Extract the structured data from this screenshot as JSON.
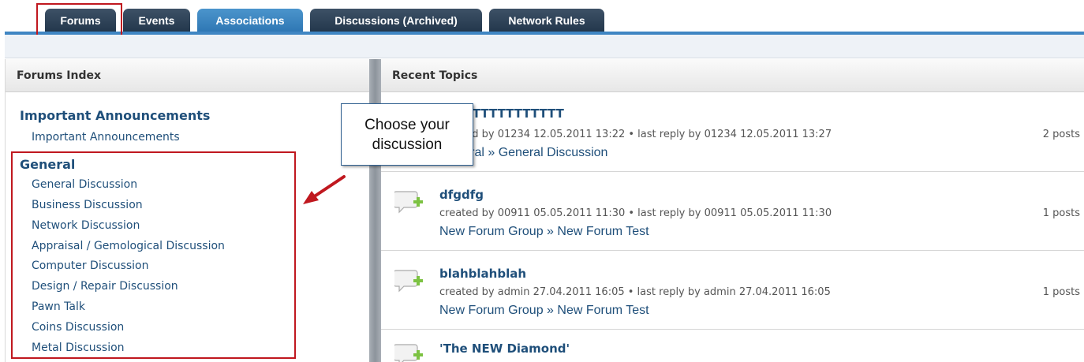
{
  "tabs": [
    {
      "label": "Forums",
      "active": false
    },
    {
      "label": "Events",
      "active": false
    },
    {
      "label": "Associations",
      "active": true
    },
    {
      "label": "Discussions (Archived)",
      "active": false
    },
    {
      "label": "Network Rules",
      "active": false
    }
  ],
  "left": {
    "header": "Forums Index",
    "groups": [
      {
        "title": "Important Announcements",
        "forums": [
          "Important Announcements"
        ]
      },
      {
        "title": "General",
        "forums": [
          "General Discussion",
          "Business Discussion",
          "Network Discussion",
          "Appraisal / Gemological Discussion",
          "Computer Discussion",
          "Design / Repair Discussion",
          "Pawn Talk",
          "Coins Discussion",
          "Metal Discussion"
        ]
      }
    ]
  },
  "right": {
    "header": "Recent Topics",
    "topics": [
      {
        "title": "TESTTTTTTTTTTTT",
        "meta": "created by 01234 12.05.2011 13:22 • last reply by 01234 12.05.2011 13:27",
        "posts": "2 posts",
        "crumb": "General » General Discussion"
      },
      {
        "title": "dfgdfg",
        "meta": "created by 00911 05.05.2011 11:30 • last reply by 00911 05.05.2011 11:30",
        "posts": "1 posts",
        "crumb": "New Forum Group » New Forum Test"
      },
      {
        "title": "blahblahblah",
        "meta": "created by admin 27.04.2011 16:05 • last reply by admin 27.04.2011 16:05",
        "posts": "1 posts",
        "crumb": "New Forum Group » New Forum Test"
      },
      {
        "title": "'The NEW Diamond'",
        "meta": "",
        "posts": "",
        "crumb": ""
      }
    ]
  },
  "callout": {
    "line1": "Choose your",
    "line2": "discussion"
  },
  "colors": {
    "tab_dark": "#2c4057",
    "tab_active": "#3a84c1",
    "link": "#1f4f7a",
    "highlight": "#c0181f"
  }
}
